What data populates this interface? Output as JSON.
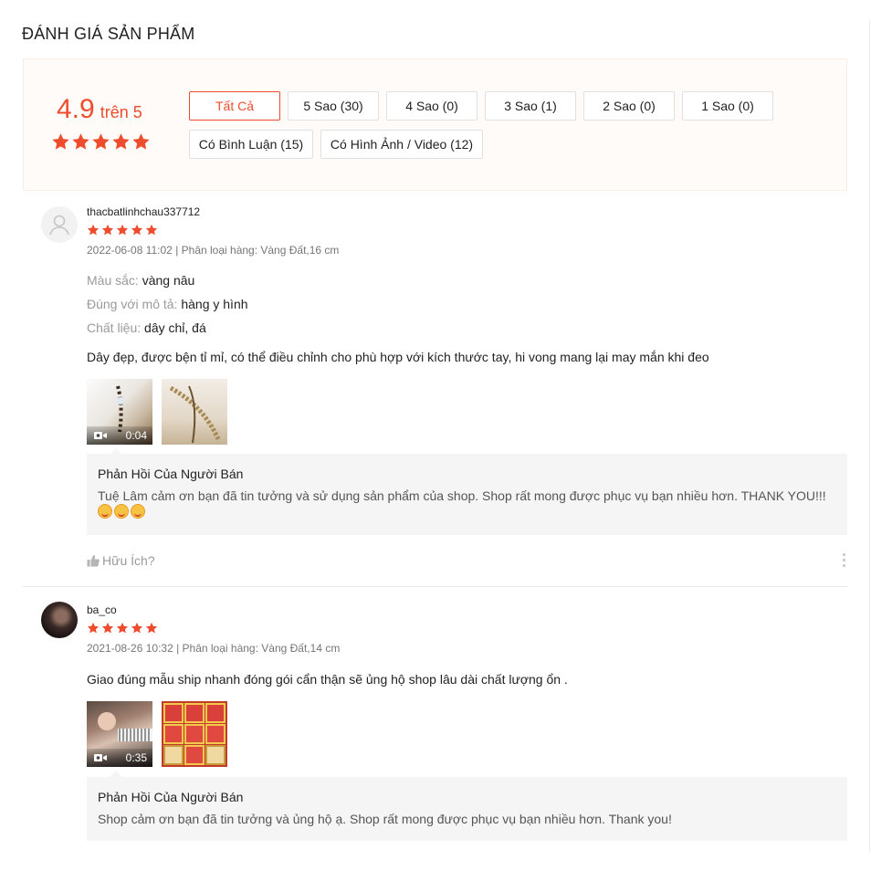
{
  "header": {
    "title": "ĐÁNH GIÁ SẢN PHẨM"
  },
  "overview": {
    "score": "4.9",
    "score_suffix": "trên 5",
    "stars": 5,
    "filters": [
      "Tất Cả",
      "5 Sao (30)",
      "4 Sao (0)",
      "3 Sao (1)",
      "2 Sao (0)",
      "1 Sao (0)",
      "Có Bình Luận (15)",
      "Có Hình Ảnh / Video (12)"
    ],
    "active_filter": "Tất Cả"
  },
  "reviews": [
    {
      "username": "thacbatlinhchau337712",
      "rating": 5,
      "meta": "2022-06-08 11:02 | Phân loại hàng: Vàng Đất,16 cm",
      "attributes": [
        {
          "key": "Màu sắc:",
          "value": "vàng nâu"
        },
        {
          "key": "Đúng với mô tả:",
          "value": "hàng y hình"
        },
        {
          "key": "Chất liệu:",
          "value": "dây chỉ, đá"
        }
      ],
      "comment": "Dây đẹp, được bện tỉ mỉ, có thể điều chỉnh cho phù hợp với kích thước tay, hi vong mang lại may mắn khi đeo",
      "video_duration": "0:04",
      "reply_title": "Phản Hồi Của Người Bán",
      "reply_text": "Tuệ Lâm cảm ơn bạn đã tin tưởng và sử dụng sản phẩm của shop. Shop rất mong được phục vụ bạn nhiều hơn. THANK YOU!!!",
      "helpful": "Hữu Ích?"
    },
    {
      "username": "ba_co",
      "rating": 5,
      "meta": "2021-08-26 10:32 | Phân loại hàng: Vàng Đất,14 cm",
      "comment": "Giao đúng mẫu ship nhanh đóng gói cẩn thận  sẽ ủng hộ shop lâu dài  chất lượng ổn .",
      "video_duration": "0:35",
      "reply_title": "Phản Hồi Của Người Bán",
      "reply_text": "Shop cảm ơn bạn đã tin tưởng và ủng hộ ạ. Shop rất mong được phục vụ bạn nhiều hơn. Thank you!"
    }
  ],
  "colors": {
    "accent": "#ee4d2d",
    "overview_bg": "#fffbf8",
    "reply_bg": "#f5f5f5"
  },
  "icons": [
    "star-icon",
    "user-placeholder-icon",
    "video-camera-icon",
    "thumbs-up-icon",
    "more-options-icon",
    "smile-emoji-icon"
  ]
}
